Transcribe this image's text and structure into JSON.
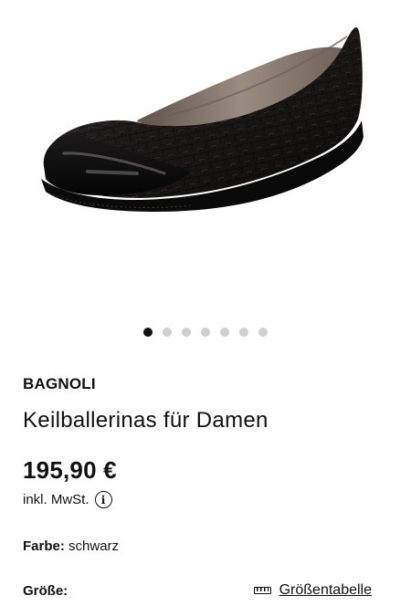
{
  "product": {
    "image_alt": "schwarzer Lack-Keilballerina mit Kroko-Prägung und Lammfell-Futter",
    "carousel": {
      "total": 7,
      "active": 0
    },
    "brand": "BAGNOLI",
    "title": "Keilballerinas für Damen",
    "price": "195,90 €",
    "tax_note": "inkl. MwSt.",
    "color_label": "Farbe:",
    "color_value": "schwarz",
    "size_label": "Größe:",
    "size_chart_label": "Größentabelle"
  }
}
